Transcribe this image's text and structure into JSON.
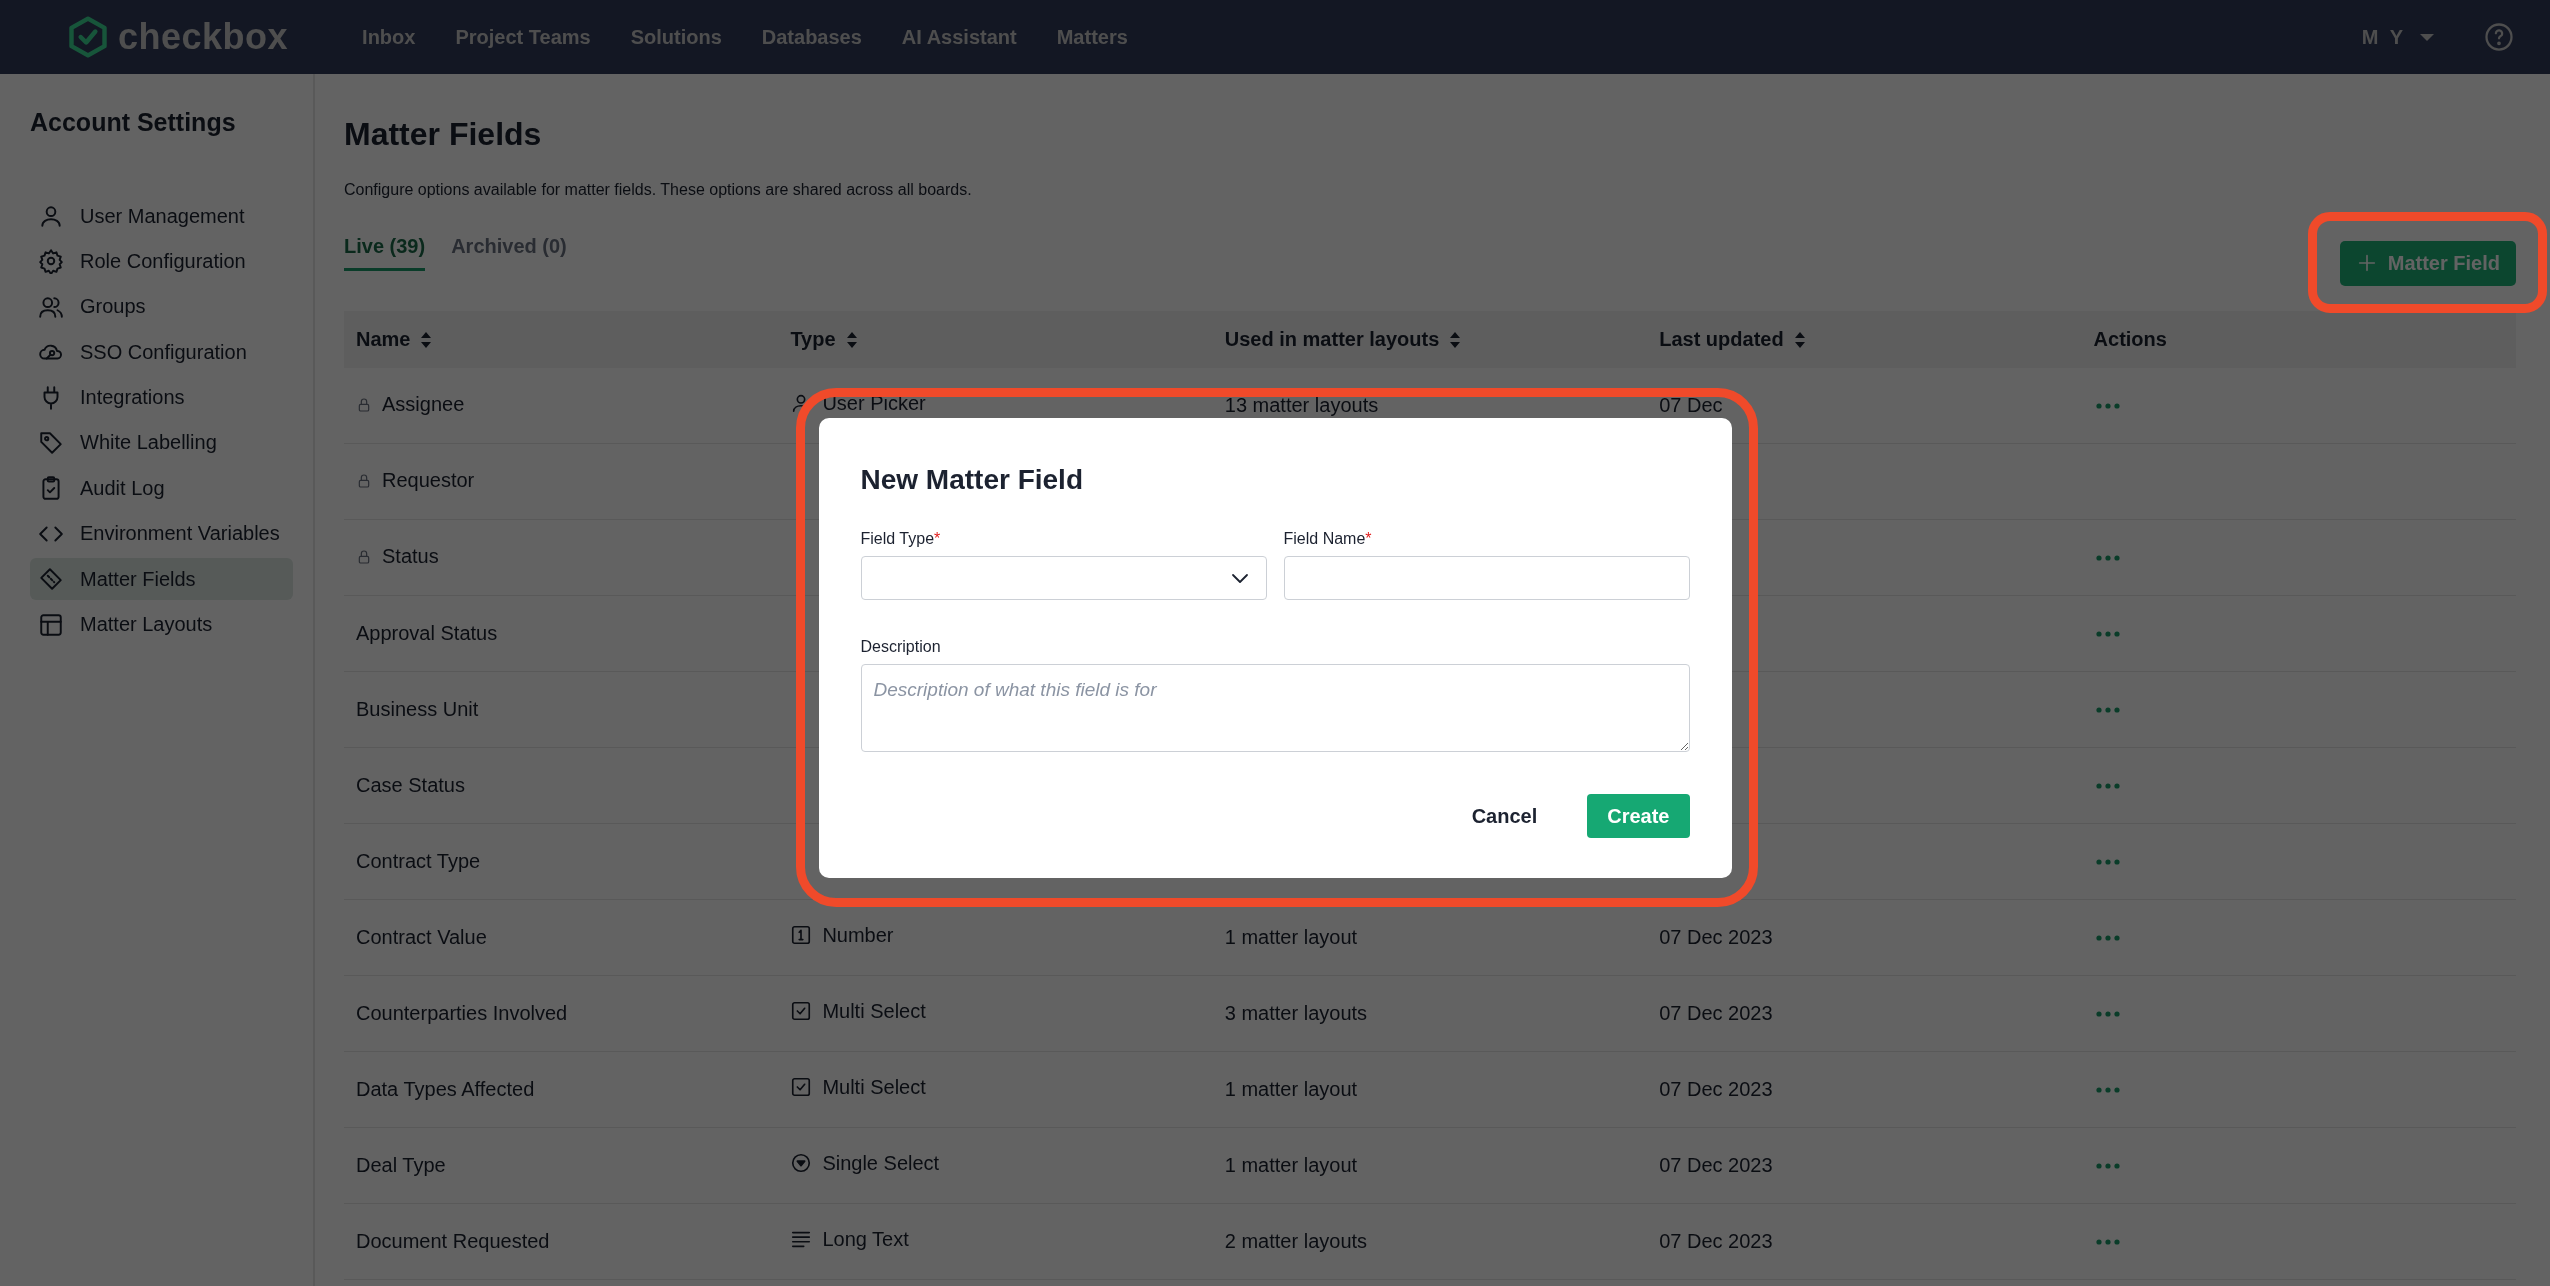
{
  "nav": {
    "logo": "checkbox",
    "links": [
      "Inbox",
      "Project Teams",
      "Solutions",
      "Databases",
      "AI Assistant",
      "Matters"
    ],
    "user": "M Y"
  },
  "sidebar": {
    "title": "Account Settings",
    "items": [
      {
        "label": "User Management",
        "selected": false
      },
      {
        "label": "Role Configuration",
        "selected": false
      },
      {
        "label": "Groups",
        "selected": false
      },
      {
        "label": "SSO Configuration",
        "selected": false
      },
      {
        "label": "Integrations",
        "selected": false
      },
      {
        "label": "White Labelling",
        "selected": false
      },
      {
        "label": "Audit Log",
        "selected": false
      },
      {
        "label": "Environment Variables",
        "selected": false
      },
      {
        "label": "Matter Fields",
        "selected": true
      },
      {
        "label": "Matter Layouts",
        "selected": false
      }
    ]
  },
  "page": {
    "title": "Matter Fields",
    "description": "Configure options available for matter fields. These options are shared across all boards.",
    "tabs": [
      {
        "label": "Live (39)",
        "selected": true
      },
      {
        "label": "Archived (0)",
        "selected": false
      }
    ],
    "add_button": "Matter Field"
  },
  "table": {
    "columns": [
      {
        "label": "Name",
        "sortable": true
      },
      {
        "label": "Type",
        "sortable": true
      },
      {
        "label": "Used in matter layouts",
        "sortable": true
      },
      {
        "label": "Last updated",
        "sortable": true
      },
      {
        "label": "Actions",
        "sortable": false
      }
    ],
    "rows": [
      {
        "name": "Assignee",
        "locked": true,
        "type": {
          "kind": "user",
          "label": "User Picker"
        },
        "used": "13 matter layouts",
        "updated": "07 Dec",
        "actions": true
      },
      {
        "name": "Requestor",
        "locked": true,
        "actions": false
      },
      {
        "name": "Status",
        "locked": true,
        "actions": true
      },
      {
        "name": "Approval Status",
        "locked": false,
        "actions": true
      },
      {
        "name": "Business Unit",
        "locked": false,
        "actions": true
      },
      {
        "name": "Case Status",
        "locked": false,
        "actions": true
      },
      {
        "name": "Contract Type",
        "locked": false,
        "actions": true
      },
      {
        "name": "Contract Value",
        "locked": false,
        "type": {
          "kind": "number",
          "label": "Number"
        },
        "used": "1 matter layout",
        "updated": "07 Dec 2023",
        "actions": true
      },
      {
        "name": "Counterparties Involved",
        "locked": false,
        "type": {
          "kind": "multi",
          "label": "Multi Select"
        },
        "used": "3 matter layouts",
        "updated": "07 Dec 2023",
        "actions": true
      },
      {
        "name": "Data Types Affected",
        "locked": false,
        "type": {
          "kind": "multi",
          "label": "Multi Select"
        },
        "used": "1 matter layout",
        "updated": "07 Dec 2023",
        "actions": true
      },
      {
        "name": "Deal Type",
        "locked": false,
        "type": {
          "kind": "single",
          "label": "Single Select"
        },
        "used": "1 matter layout",
        "updated": "07 Dec 2023",
        "actions": true
      },
      {
        "name": "Document Requested",
        "locked": false,
        "type": {
          "kind": "long",
          "label": "Long Text"
        },
        "used": "2 matter layouts",
        "updated": "07 Dec 2023",
        "actions": true
      }
    ]
  },
  "modal": {
    "title": "New Matter Field",
    "fields": [
      {
        "label": "Field Type",
        "required": true,
        "required_mark": "*",
        "kind": "select"
      },
      {
        "label": "Field Name",
        "required": true,
        "required_mark": "*",
        "kind": "text"
      }
    ],
    "description": {
      "label": "Description",
      "placeholder": "Description of what this field is for"
    },
    "buttons": [
      {
        "label": "Cancel",
        "kind": "secondary"
      },
      {
        "label": "Create",
        "kind": "primary"
      }
    ]
  }
}
